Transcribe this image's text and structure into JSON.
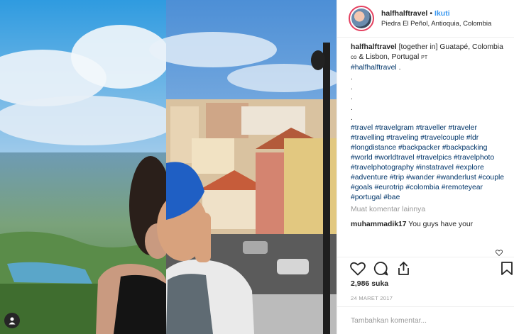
{
  "post": {
    "username": "halfhalftravel",
    "separator": "•",
    "follow_label": "Ikuti",
    "location": "Piedra El Peñol, Antioquia, Colombia"
  },
  "caption": {
    "username": "halfhalftravel",
    "text": "[together in] Guatapé, Colombia",
    "flag_co": "co",
    "text_mid": "& Lisbon, Portugal",
    "flag_pt": "PT",
    "first_tag": "#halfhalftravel",
    "first_tag_suffix": ".",
    "dot_lines": [
      ".",
      ".",
      ".",
      ".",
      "."
    ],
    "hashtags": [
      "#travel",
      "#travelgram",
      "#traveller",
      "#traveler",
      "#travelling",
      "#traveling",
      "#travelcouple",
      "#ldr",
      "#longdistance",
      "#backpacker",
      "#backpacking",
      "#world",
      "#worldtravel",
      "#travelpics",
      "#travelphoto",
      "#travelphotography",
      "#instatravel",
      "#explore",
      "#adventure",
      "#trip",
      "#wander",
      "#wanderlust",
      "#couple",
      "#goals",
      "#eurotrip",
      "#colombia",
      "#remoteyear",
      "#portugal",
      "#bae"
    ]
  },
  "load_more": "Muat komentar lainnya",
  "comment": {
    "username": "muhammadik17",
    "text": "You guys have your"
  },
  "actions": {
    "like_icon": "heart-icon",
    "comment_icon": "comment-icon",
    "share_icon": "share-icon",
    "save_icon": "bookmark-icon"
  },
  "likes": "2,986 suka",
  "date": "24 MARET 2017",
  "add_comment_placeholder": "Tambahkan komentar...",
  "colors": {
    "follow": "#3897f0",
    "hashtag": "#003569",
    "muted": "#999999"
  }
}
